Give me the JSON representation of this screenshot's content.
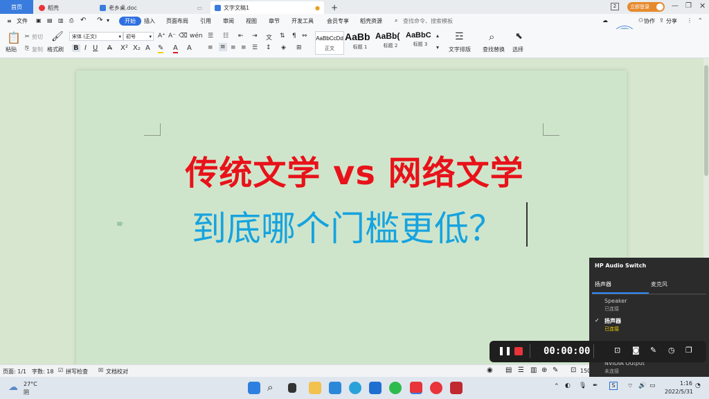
{
  "tabs": {
    "home": "首页",
    "daoke": "稻壳",
    "doc1": "老乡桌.doc",
    "doc2": "文字文稿1",
    "add": "+"
  },
  "window": {
    "tab_count": "2",
    "login": "立即登录"
  },
  "menu": {
    "file": "文件",
    "start": "开始",
    "insert": "插入",
    "layout": "页面布局",
    "reference": "引用",
    "review": "审阅",
    "view": "视图",
    "chapter": "章节",
    "devtools": "开发工具",
    "member": "会员专享",
    "resources": "稻壳资源",
    "search_placeholder": "查找命令、搜索模板",
    "collab": "协作",
    "share": "分享"
  },
  "ribbon": {
    "paste": "粘贴",
    "cut": "剪切",
    "copy": "复制",
    "format_painter": "格式刷",
    "font_name": "宋体 (正文)",
    "font_size": "初号",
    "styles": [
      {
        "sample": "AaBbCcDd",
        "name": "正文"
      },
      {
        "sample": "AaBb",
        "name": "标题 1"
      },
      {
        "sample": "AaBb(",
        "name": "标题 2"
      },
      {
        "sample": "AaBbC",
        "name": "标题 3"
      }
    ],
    "text_layout": "文字排版",
    "find_replace": "查找替换",
    "select": "选择"
  },
  "document": {
    "line1": "传统文学 vs 网络文学",
    "line2": "到底哪个门槛更低？"
  },
  "status": {
    "page": "页面: 1/1",
    "words": "字数: 18",
    "spell": "拼写检查",
    "proof": "文档校对",
    "zoom": "150"
  },
  "audio_switch": {
    "title": "HP Audio Switch",
    "tab_speaker": "扬声器",
    "tab_mic": "麦克风",
    "devices": [
      {
        "name": "Speaker",
        "status": "已连接"
      },
      {
        "name": "扬声器",
        "status": "已连接"
      },
      {
        "name": "NVIDIA Output",
        "status": "未连接"
      }
    ]
  },
  "recorder": {
    "time": "00:00:00"
  },
  "weather": {
    "temp": "27°C",
    "cond": "阴"
  },
  "clock": {
    "time": "1:16",
    "date": "2022/5/31"
  },
  "colors": {
    "accent": "#2f6fe0",
    "title_red": "#e8121a",
    "subtitle_blue": "#16a3df",
    "page_bg": "#cfe5cb"
  }
}
